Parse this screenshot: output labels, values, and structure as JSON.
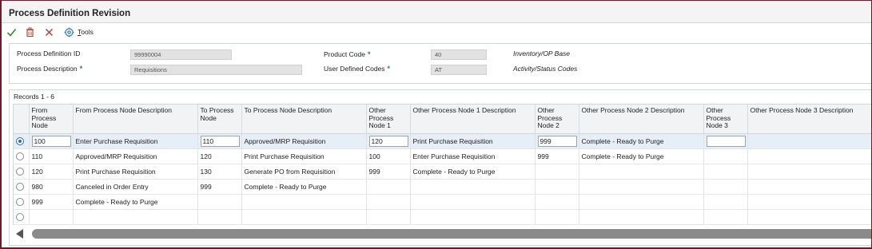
{
  "window": {
    "title": "Process Definition Revision"
  },
  "toolbar": {
    "ok_icon": "check-icon",
    "delete_icon": "trash-icon",
    "cancel_icon": "close-icon",
    "tools_icon": "gear-icon",
    "tools_label_first": "T",
    "tools_label_rest": "ools",
    "colors": {
      "ok": "#3a8a3a",
      "delete": "#c0392b",
      "cancel": "#c0392b",
      "tools": "#2f6fb7"
    }
  },
  "header": {
    "process_definition_id": {
      "label": "Process Definition ID",
      "value": "99990004"
    },
    "process_description": {
      "label": "Process Description",
      "required": "*",
      "value": "Requisitions"
    },
    "product_code": {
      "label": "Product Code",
      "required": "*",
      "value": "40",
      "description": "Inventory/OP Base"
    },
    "user_defined_codes": {
      "label": "User Defined Codes",
      "required": "*",
      "value": "AT",
      "description": "Activity/Status Codes"
    }
  },
  "grid": {
    "records_label": "Records 1 - 6",
    "columns": [
      "From Process Node",
      "From Process Node Description",
      "To Process Node",
      "To Process Node Description",
      "Other Process Node 1",
      "Other Process Node 1 Description",
      "Other Process Node 2",
      "Other Process Node 2 Description",
      "Other Process Node 3",
      "Other Process Node 3 Description"
    ],
    "rows": [
      [
        "100",
        "Enter Purchase Requisition",
        "110",
        "Approved/MRP Requisition",
        "120",
        "Print Purchase Requisition",
        "999",
        "Complete - Ready to Purge",
        "",
        ""
      ],
      [
        "110",
        "Approved/MRP Requisition",
        "120",
        "Print Purchase Requisition",
        "100",
        "Enter Purchase Requisition",
        "999",
        "Complete - Ready to Purge",
        "",
        ""
      ],
      [
        "120",
        "Print Purchase Requisition",
        "130",
        "Generate PO from Requisition",
        "999",
        "Complete - Ready to Purge",
        "",
        "",
        "",
        ""
      ],
      [
        "980",
        "Canceled in Order Entry",
        "999",
        "Complete - Ready to Purge",
        "",
        "",
        "",
        "",
        "",
        ""
      ],
      [
        "999",
        "Complete - Ready to Purge",
        "",
        "",
        "",
        "",
        "",
        "",
        "",
        ""
      ],
      [
        "",
        "",
        "",
        "",
        "",
        "",
        "",
        "",
        "",
        ""
      ]
    ],
    "selected_row": 0
  },
  "colors": {
    "accent": "#2f6fb7",
    "frame": "#6b1b2a",
    "readonly_field": "#e2e2e2",
    "selected_row": "#e6eef7"
  }
}
